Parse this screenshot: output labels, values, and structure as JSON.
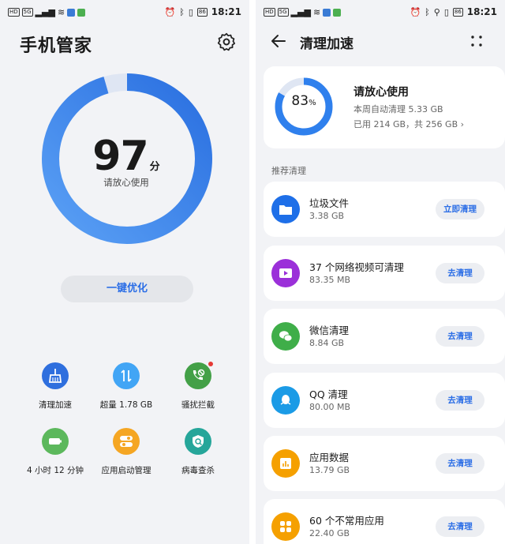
{
  "status_bar": {
    "time": "18:21",
    "battery": "86",
    "hd_label": "HD",
    "net_label": "5G"
  },
  "home": {
    "title": "手机管家",
    "score": "97",
    "score_unit": "分",
    "score_label": "请放心使用",
    "score_value": 97,
    "optimize_button": "一键优化",
    "tools": [
      {
        "label": "清理加速",
        "icon": "broom-icon",
        "color": "#2f6fde"
      },
      {
        "label": "超量 1.78 GB",
        "icon": "data-transfer-icon",
        "color": "#42a5f5"
      },
      {
        "label": "骚扰拦截",
        "icon": "phone-block-icon",
        "color": "#43a047",
        "badge": true
      },
      {
        "label": "4 小时 12 分钟",
        "icon": "battery-icon",
        "color": "#5cb85c"
      },
      {
        "label": "应用启动管理",
        "icon": "toggle-icon",
        "color": "#f5a623"
      },
      {
        "label": "病毒查杀",
        "icon": "shield-scan-icon",
        "color": "#26a69a"
      }
    ]
  },
  "cleanup": {
    "title": "清理加速",
    "percent": "83",
    "percent_unit": "%",
    "used_fraction": 0.83,
    "status": "请放心使用",
    "weekly_auto": "本周自动清理 5.33 GB",
    "usage": "已用 214 GB，共 256 GB",
    "section_label": "推荐清理",
    "items": [
      {
        "name": "垃圾文件",
        "size": "3.38 GB",
        "button": "立即清理",
        "icon": "folder-icon",
        "color": "#1e6fe8"
      },
      {
        "name": "37 个网络视频可清理",
        "size": "83.35 MB",
        "button": "去清理",
        "icon": "video-icon",
        "color": "#9b30d9"
      },
      {
        "name": "微信清理",
        "size": "8.84 GB",
        "button": "去清理",
        "icon": "wechat-icon",
        "color": "#3fae49"
      },
      {
        "name": "QQ 清理",
        "size": "80.00 MB",
        "button": "去清理",
        "icon": "qq-icon",
        "color": "#1b9be6"
      },
      {
        "name": "应用数据",
        "size": "13.79 GB",
        "button": "去清理",
        "icon": "app-data-icon",
        "color": "#f5a000"
      },
      {
        "name": "60 个不常用应用",
        "size": "22.40 GB",
        "button": "去清理",
        "icon": "apps-grid-icon",
        "color": "#f5a000"
      }
    ]
  }
}
